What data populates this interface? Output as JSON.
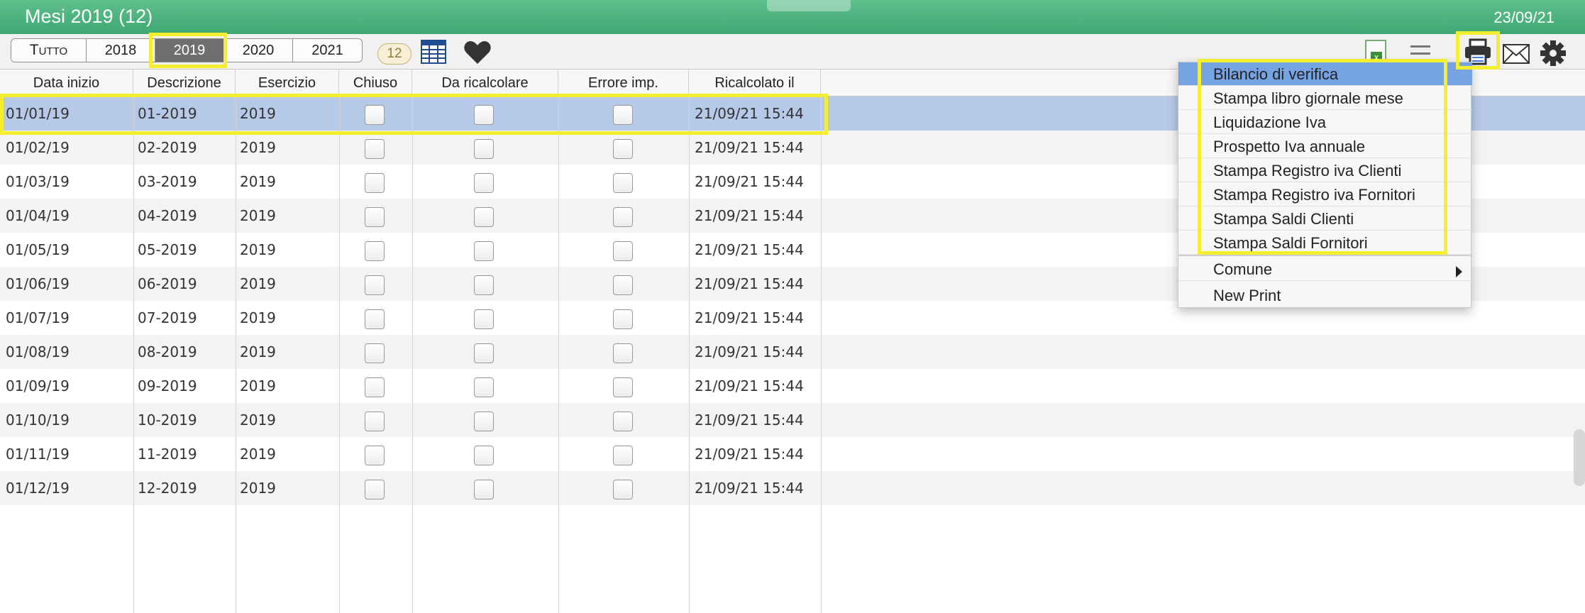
{
  "window": {
    "title": "Mesi 2019 (12)",
    "date": "23/09/21"
  },
  "toolbar": {
    "years": [
      "Tutto",
      "2018",
      "2019",
      "2020",
      "2021"
    ],
    "selected_year": "2019",
    "count_badge": "12",
    "icons": [
      "table-icon",
      "heart-icon",
      "excel-icon",
      "list-icon",
      "print-icon",
      "mail-icon",
      "gear-icon"
    ]
  },
  "table": {
    "columns": [
      "Data inizio",
      "Descrizione",
      "Esercizio",
      "Chiuso",
      "Da ricalcolare",
      "Errore imp.",
      "Ricalcolato il"
    ],
    "rows": [
      {
        "data_inizio": "01/01/19",
        "descrizione": "01-2019",
        "esercizio": "2019",
        "ricalcolato": "21/09/21 15:44"
      },
      {
        "data_inizio": "01/02/19",
        "descrizione": "02-2019",
        "esercizio": "2019",
        "ricalcolato": "21/09/21 15:44"
      },
      {
        "data_inizio": "01/03/19",
        "descrizione": "03-2019",
        "esercizio": "2019",
        "ricalcolato": "21/09/21 15:44"
      },
      {
        "data_inizio": "01/04/19",
        "descrizione": "04-2019",
        "esercizio": "2019",
        "ricalcolato": "21/09/21 15:44"
      },
      {
        "data_inizio": "01/05/19",
        "descrizione": "05-2019",
        "esercizio": "2019",
        "ricalcolato": "21/09/21 15:44"
      },
      {
        "data_inizio": "01/06/19",
        "descrizione": "06-2019",
        "esercizio": "2019",
        "ricalcolato": "21/09/21 15:44"
      },
      {
        "data_inizio": "01/07/19",
        "descrizione": "07-2019",
        "esercizio": "2019",
        "ricalcolato": "21/09/21 15:44"
      },
      {
        "data_inizio": "01/08/19",
        "descrizione": "08-2019",
        "esercizio": "2019",
        "ricalcolato": "21/09/21 15:44"
      },
      {
        "data_inizio": "01/09/19",
        "descrizione": "09-2019",
        "esercizio": "2019",
        "ricalcolato": "21/09/21 15:44"
      },
      {
        "data_inizio": "01/10/19",
        "descrizione": "10-2019",
        "esercizio": "2019",
        "ricalcolato": "21/09/21 15:44"
      },
      {
        "data_inizio": "01/11/19",
        "descrizione": "11-2019",
        "esercizio": "2019",
        "ricalcolato": "21/09/21 15:44"
      },
      {
        "data_inizio": "01/12/19",
        "descrizione": "12-2019",
        "esercizio": "2019",
        "ricalcolato": "21/09/21 15:44"
      }
    ]
  },
  "print_menu": {
    "items": [
      "Bilancio di verifica",
      "Stampa libro giornale mese",
      "Liquidazione Iva",
      "Prospetto Iva annuale",
      "Stampa Registro iva Clienti",
      "Stampa Registro iva Fornitori",
      "Stampa Saldi Clienti",
      "Stampa Saldi Fornitori"
    ],
    "submenu": "Comune",
    "extra": "New Print"
  },
  "colors": {
    "title_bar": "#3fa872",
    "selection": "#b6c9e8",
    "menu_active": "#76a3e3",
    "highlight": "#f3ef2e"
  }
}
